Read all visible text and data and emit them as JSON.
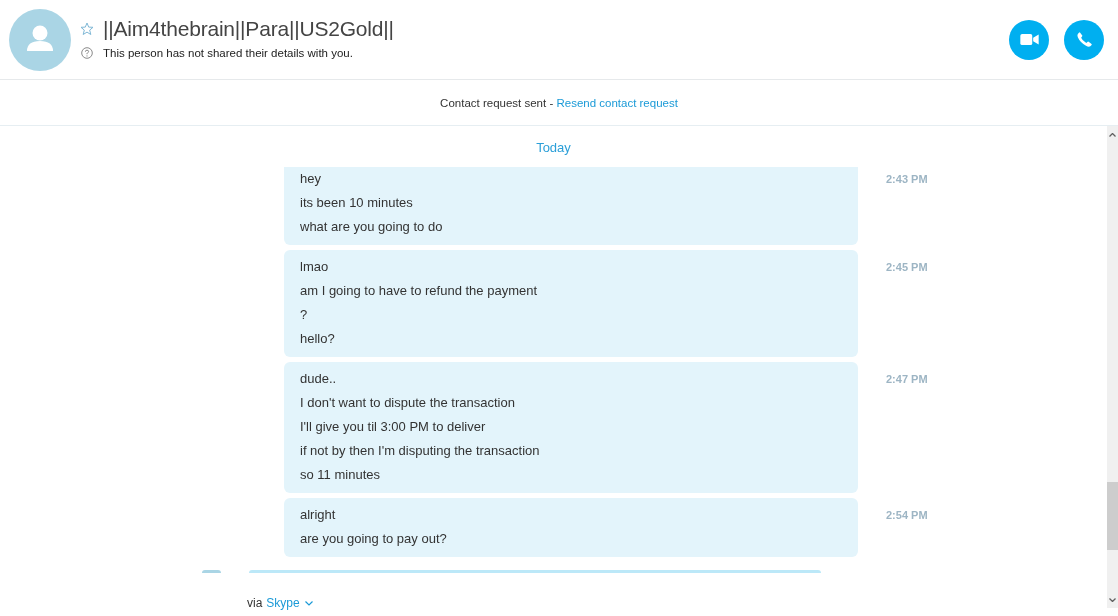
{
  "contact": {
    "name": "||Aim4thebrain||Para||US2Gold||",
    "favorite": false,
    "status_text": "This person has not shared their details with you."
  },
  "contact_request": {
    "text": "Contact request sent -",
    "link": "Resend contact request"
  },
  "conversation": {
    "date_divider": "Today",
    "messages": [
      {
        "time": "2:43 PM",
        "lines": [
          "hey",
          "its been 10 minutes",
          "what are you going to do"
        ]
      },
      {
        "time": "2:45 PM",
        "lines": [
          "lmao",
          "am I going to have to refund the payment",
          "?",
          "hello?"
        ]
      },
      {
        "time": "2:47 PM",
        "lines": [
          "dude..",
          "I don't want to dispute the transaction",
          "I'll give you til 3:00 PM to deliver",
          "if not by then I'm disputing the transaction",
          "so 11 minutes"
        ]
      },
      {
        "time": "2:54 PM",
        "lines": [
          "alright",
          "are you going to pay out?"
        ]
      }
    ]
  },
  "composer": {
    "via_text": "via",
    "via_link": "Skype"
  }
}
